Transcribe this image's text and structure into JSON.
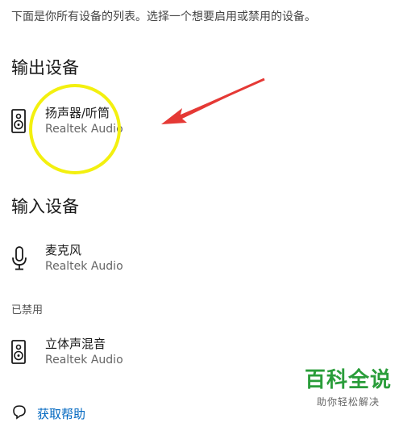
{
  "intro_text": "下面是你所有设备的列表。选择一个想要启用或禁用的设备。",
  "output_section": {
    "title": "输出设备",
    "devices": [
      {
        "name": "扬声器/听筒",
        "driver": "Realtek Audio",
        "icon": "speaker-icon"
      }
    ]
  },
  "input_section": {
    "title": "输入设备",
    "devices": [
      {
        "name": "麦克风",
        "driver": "Realtek Audio",
        "icon": "microphone-icon"
      }
    ]
  },
  "disabled_section": {
    "label": "已禁用",
    "devices": [
      {
        "name": "立体声混音",
        "driver": "Realtek Audio",
        "icon": "speaker-icon"
      }
    ]
  },
  "help_link": {
    "label": "获取帮助",
    "icon": "help-icon"
  },
  "watermark": {
    "title": "百科全说",
    "subtitle": "助你轻松解决"
  },
  "colors": {
    "annotation_circle": "#f3f00f",
    "annotation_arrow": "#e53935",
    "watermark_green": "#2a9d3a",
    "link_blue": "#0067c0"
  }
}
